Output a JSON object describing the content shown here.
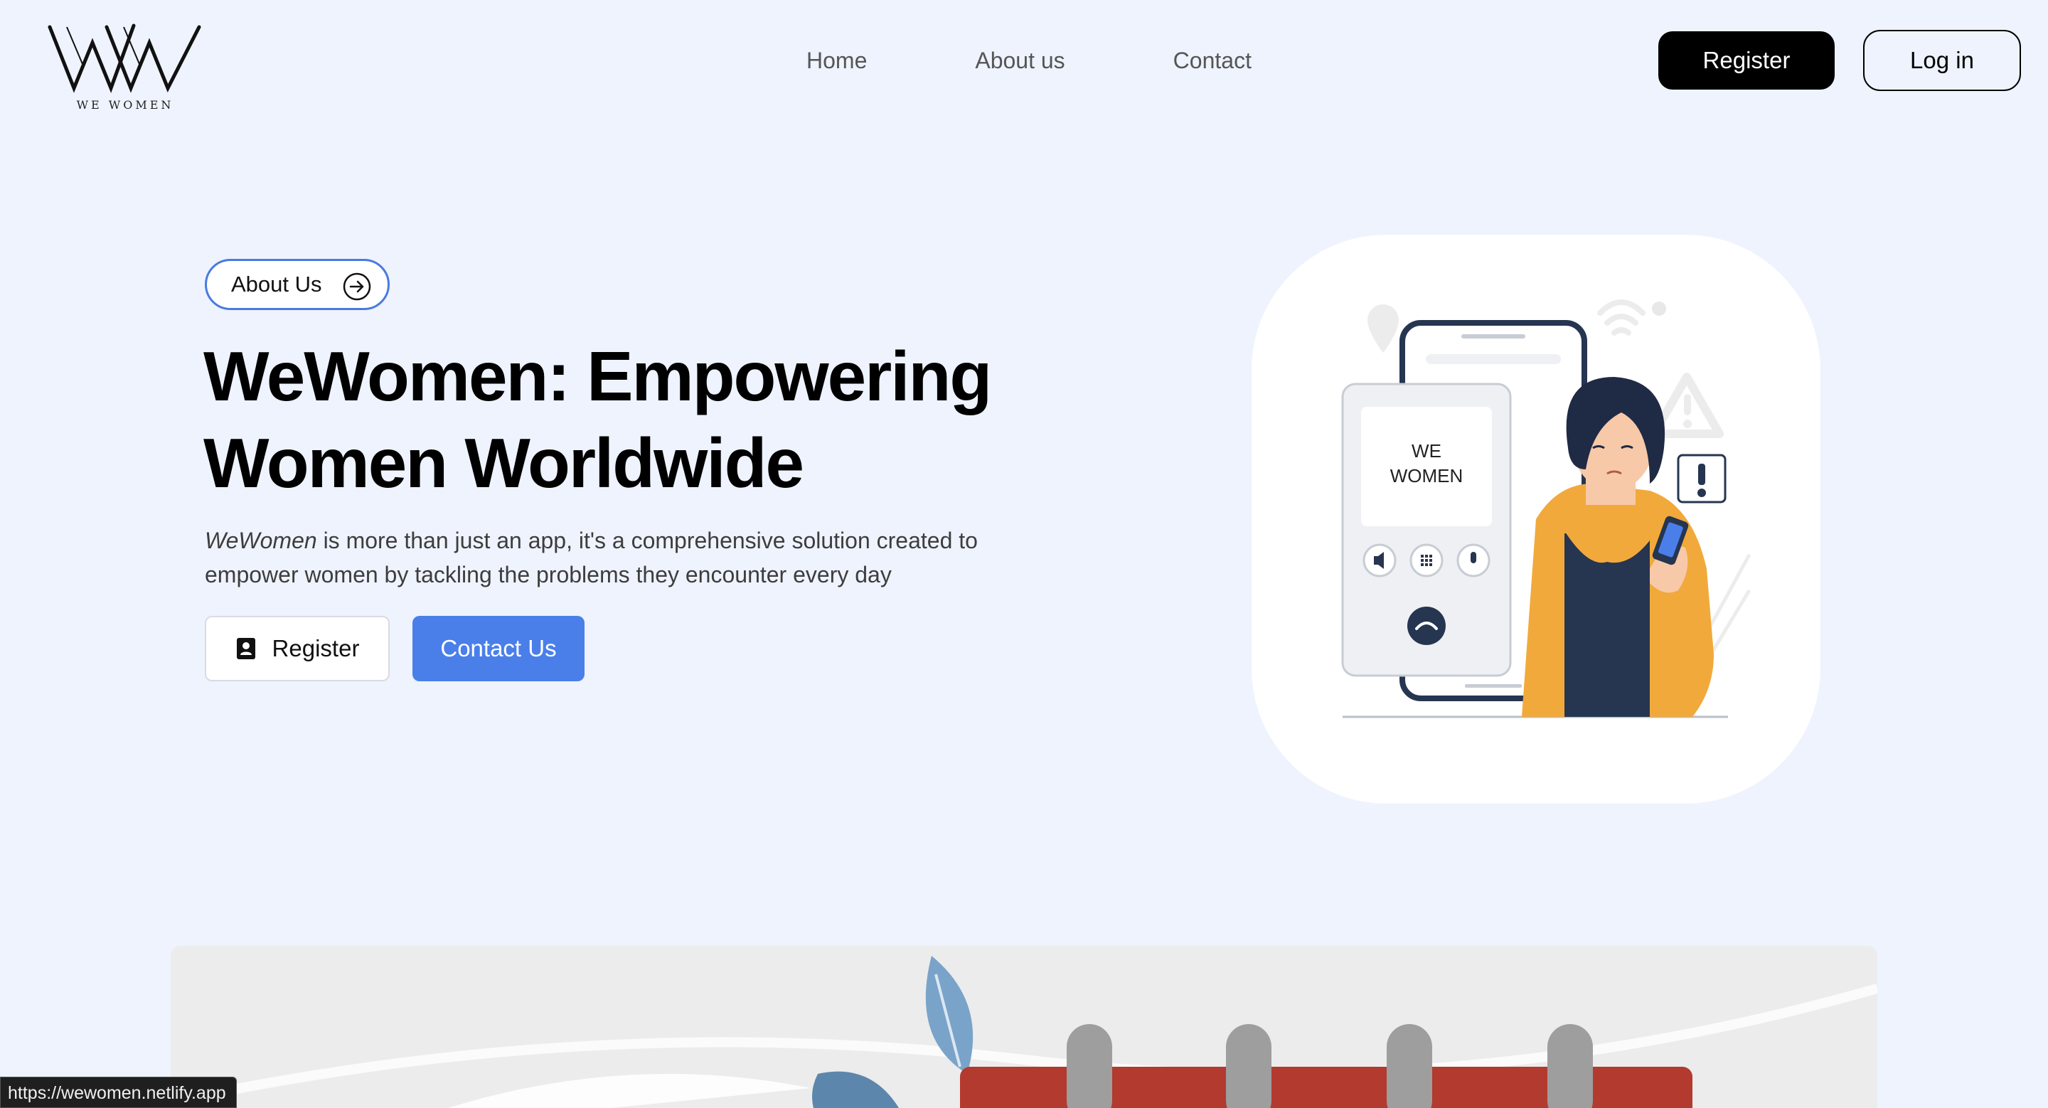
{
  "nav": {
    "logo_monogram": "WW",
    "logo_text": "WE WOMEN",
    "links": [
      "Home",
      "About us",
      "Contact"
    ],
    "register_label": "Register",
    "login_label": "Log in"
  },
  "hero": {
    "pill_label": "About Us",
    "title_line1": "WeWomen: Empowering",
    "title_line2": "Women Worldwide",
    "desc_brand": "WeWomen",
    "desc_rest": " is more than just an app, it's a comprehensive solution created to empower women by tackling the problems they encounter every day",
    "register_label": "Register",
    "contact_label": "Contact Us"
  },
  "illustration": {
    "phone_text_line1": "WE",
    "phone_text_line2": "WOMEN"
  },
  "status_bar": {
    "url": "https://wewomen.netlify.app"
  },
  "colors": {
    "background": "#eef3fe",
    "accent_blue": "#4a7fea",
    "pill_border": "#4a7adf",
    "shirt_orange": "#f2a93b",
    "calendar_red": "#b33a2f",
    "navy": "#263550"
  }
}
